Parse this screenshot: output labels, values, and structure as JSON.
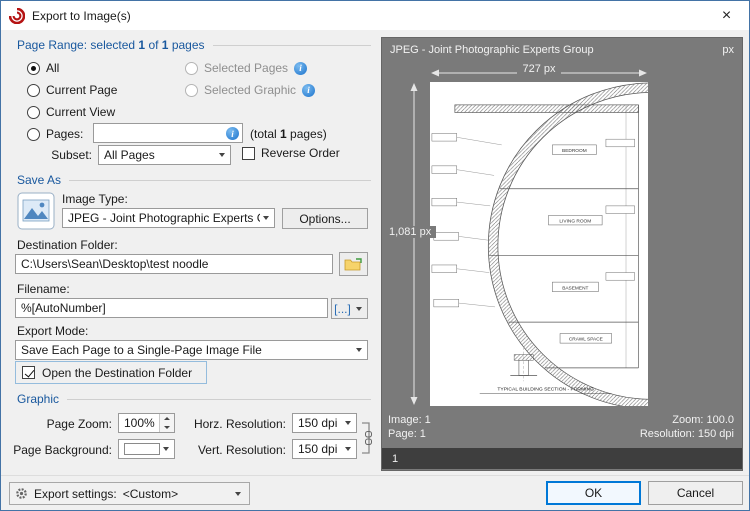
{
  "window": {
    "title": "Export to Image(s)",
    "close_label": "×"
  },
  "page_range": {
    "header_pre": "Page Range: selected ",
    "header_n1": "1",
    "header_mid": " of ",
    "header_n2": "1",
    "header_post": " pages",
    "all_label": "All",
    "current_page_label": "Current Page",
    "current_view_label": "Current View",
    "pages_label": "Pages:",
    "pages_value": "",
    "total_pre": "(total ",
    "total_n": "1",
    "total_post": " pages)",
    "selected_pages_label": "Selected Pages",
    "selected_graphic_label": "Selected Graphic",
    "subset_label": "Subset:",
    "subset_value": "All Pages",
    "reverse_order_label": "Reverse Order"
  },
  "save_as": {
    "header": "Save As",
    "image_type_label": "Image Type:",
    "image_type_value": "JPEG - Joint Photographic Experts Group",
    "options_button": "Options...",
    "destination_label": "Destination Folder:",
    "destination_value": "C:\\Users\\Sean\\Desktop\\test noodle",
    "filename_label": "Filename:",
    "filename_value": "%[AutoNumber]",
    "macro_button": "[...]",
    "export_mode_label": "Export Mode:",
    "export_mode_value": "Save Each Page to a Single-Page Image File",
    "open_folder_label": "Open the Destination Folder"
  },
  "graphic": {
    "header": "Graphic",
    "page_zoom_label": "Page Zoom:",
    "page_zoom_value": "100%",
    "horz_resolution_label": "Horz. Resolution:",
    "horz_resolution_value": "150 dpi",
    "page_background_label": "Page Background:",
    "vert_resolution_label": "Vert. Resolution:",
    "vert_resolution_value": "150 dpi"
  },
  "preview": {
    "header": "JPEG - Joint Photographic Experts Group",
    "unit_label": "px",
    "width_label": "727 px",
    "height_label": "1,081 px",
    "image_label": "Image: 1",
    "page_label": "Page: 1",
    "zoom_label": "Zoom: 100.0",
    "resolution_label": "Resolution: 150 dpi",
    "thumb_index": "1",
    "drawing": {
      "rooms": [
        "BEDROOM",
        "LIVING ROOM",
        "BASEMENT",
        "CRAWL SPACE"
      ],
      "caption": "TYPICAL BUILDING SECTION - FORMING"
    }
  },
  "footer": {
    "export_settings_label": "Export settings:",
    "export_settings_value": "<Custom>",
    "ok_label": "OK",
    "cancel_label": "Cancel"
  },
  "colors": {
    "accent": "#0078d7",
    "section_header": "#19589e",
    "preview_background": "#7a7a7a"
  }
}
